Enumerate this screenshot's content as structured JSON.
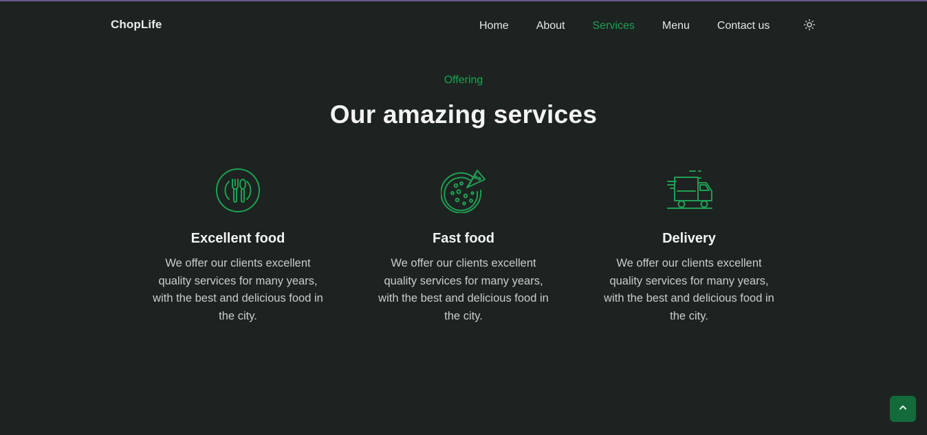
{
  "header": {
    "logo": "ChopLife",
    "nav": [
      {
        "label": "Home"
      },
      {
        "label": "About"
      },
      {
        "label": "Services"
      },
      {
        "label": "Menu"
      },
      {
        "label": "Contact us"
      }
    ],
    "active_nav": "Services",
    "theme_toggle_icon": "sun-icon"
  },
  "services": {
    "subtitle": "Offering",
    "title": "Our amazing services",
    "cards": [
      {
        "icon": "restaurant-icon",
        "title": "Excellent food",
        "description": "We offer our clients excellent quality services for many years, with the best and delicious food in the city."
      },
      {
        "icon": "pizza-icon",
        "title": "Fast food",
        "description": "We offer our clients excellent quality services for many years, with the best and delicious food in the city."
      },
      {
        "icon": "delivery-truck-icon",
        "title": "Delivery",
        "description": "We offer our clients excellent quality services for many years, with the best and delicious food in the city."
      }
    ]
  },
  "scroll_up": {
    "icon": "chevron-up-icon"
  },
  "colors": {
    "background": "#1d2320",
    "accent": "#1fa055",
    "scroll_button": "#136b3b",
    "text": "#f2f4f3"
  }
}
